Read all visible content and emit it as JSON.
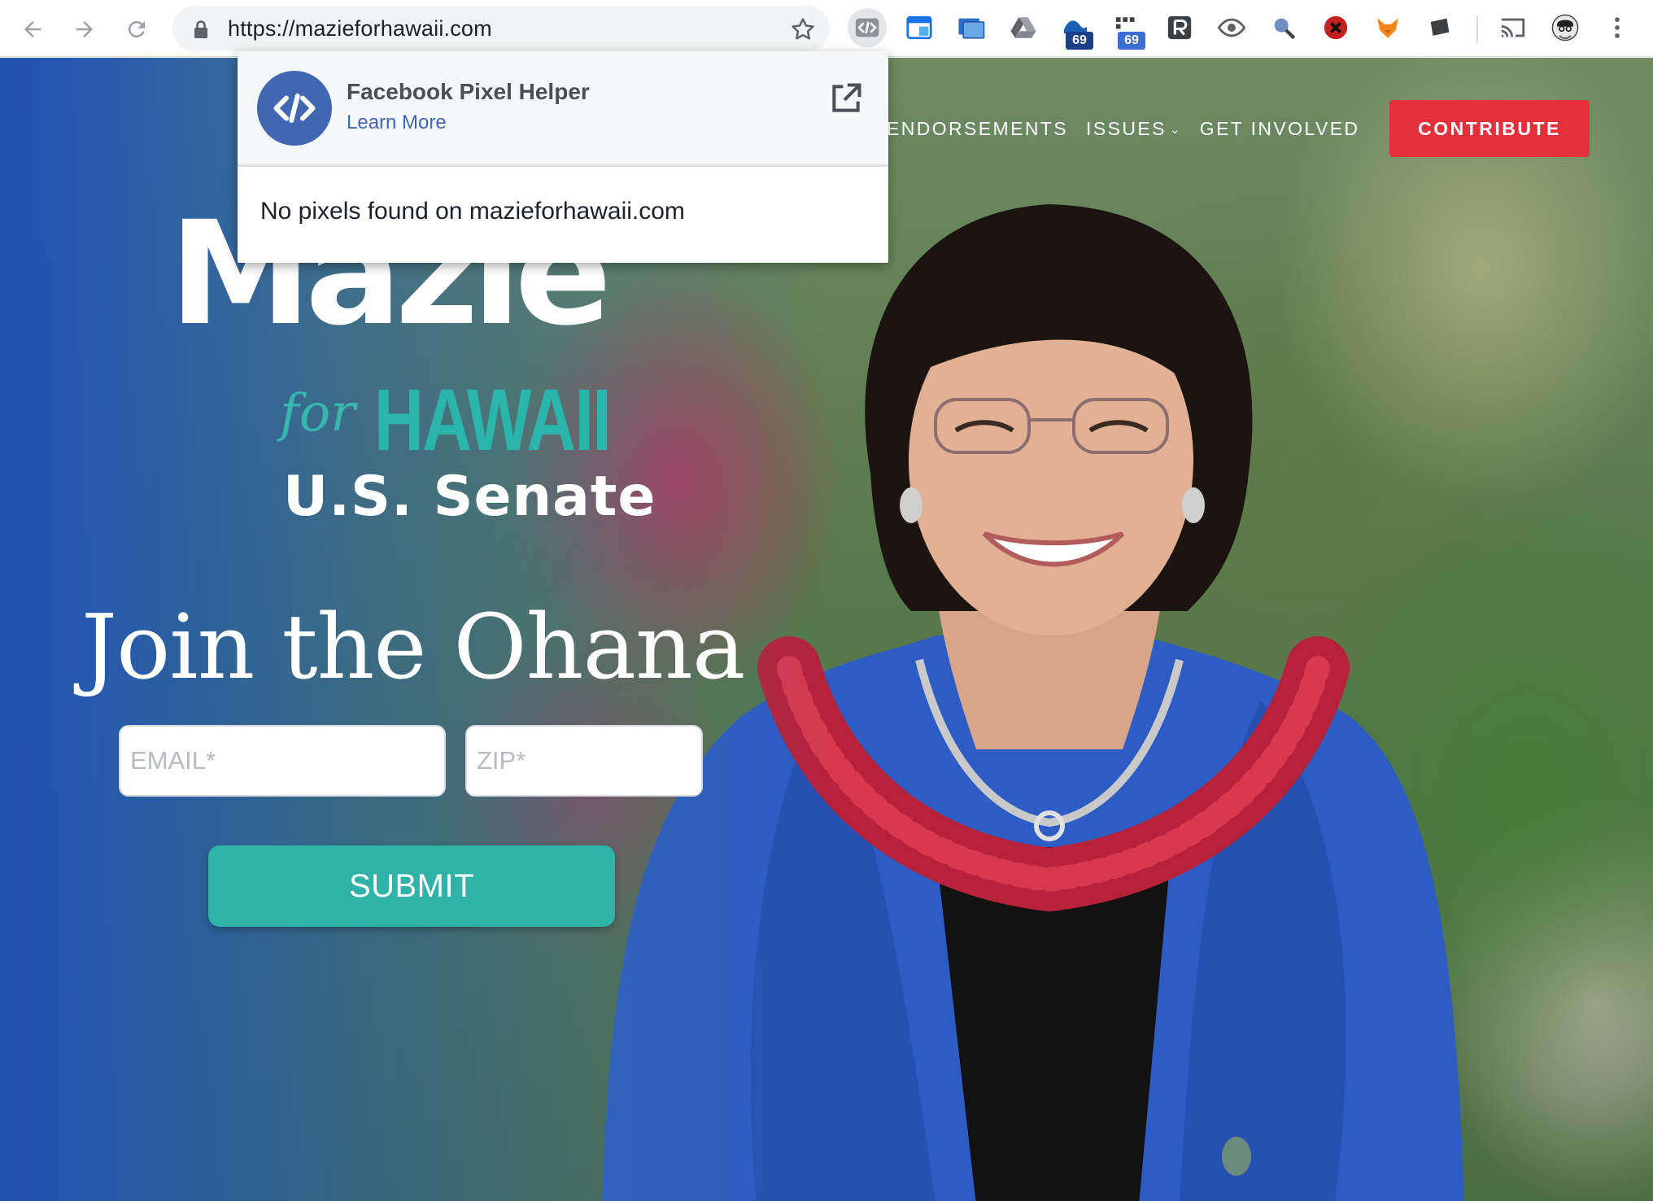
{
  "browser": {
    "url": "https://mazieforhawaii.com",
    "extension_badges": [
      "69",
      "69"
    ]
  },
  "site": {
    "nav": {
      "endorsements": "ENDORSEMENTS",
      "issues": "ISSUES",
      "get_involved": "GET INVOLVED",
      "contribute": "CONTRIBUTE"
    },
    "logo": {
      "name": "Mazie",
      "for": "for",
      "state": "HAWAII",
      "office": "U.S. Senate"
    },
    "signup": {
      "title": "Join the Ohana",
      "email_placeholder": "EMAIL*",
      "zip_placeholder": "ZIP*",
      "submit_label": "SUBMIT"
    }
  },
  "popup": {
    "title": "Facebook Pixel Helper",
    "learn_more": "Learn More",
    "message": "No pixels found on mazieforhawaii.com"
  },
  "colors": {
    "contribute_red": "#e52f3a",
    "teal": "#2fb3a9",
    "hero_blue": "#1e52b0",
    "facebook_blue": "#4267b2"
  }
}
